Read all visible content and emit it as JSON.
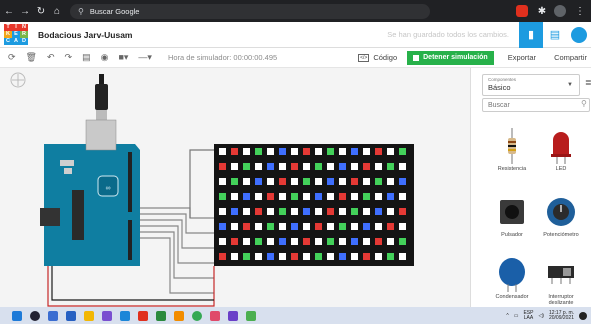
{
  "browser": {
    "omnibox_text": "Buscar Google",
    "back_icon": "back-arrow-icon",
    "forward_icon": "forward-arrow-icon",
    "reload_icon": "reload-icon",
    "home_icon": "home-icon"
  },
  "header": {
    "logo_letters": [
      "T",
      "I",
      "N",
      "K",
      "E",
      "R",
      "C",
      "A",
      "D"
    ],
    "logo_colors": [
      "#e8362a",
      "#e8362a",
      "#e8362a",
      "#f1a71a",
      "#1d9be0",
      "#7ab648",
      "#1d9be0",
      "#1d9be0",
      "#1d9be0"
    ],
    "project_name": "Bodacious Jarv-Uusam",
    "save_status": "Se han guardado todos los cambios."
  },
  "toolbar": {
    "sim_time": "Hora de simulador: 00:00:00.495",
    "code_label": "Código",
    "stop_label": "Detener simulación",
    "export_label": "Exportar",
    "share_label": "Compartir"
  },
  "panel": {
    "components_label": "Componentes",
    "components_value": "Básico",
    "search_placeholder": "Buscar",
    "items": [
      {
        "label": "Resistencia"
      },
      {
        "label": "LED"
      },
      {
        "label": "Pulsador"
      },
      {
        "label": "Potenciómetro"
      },
      {
        "label": "Condensador"
      },
      {
        "label": "Interruptor deslizante"
      }
    ]
  },
  "taskbar": {
    "lang": "ESP",
    "lang_sub": "LAA",
    "time": "12:17 p. m.",
    "date": "20/09/2021"
  },
  "colors": {
    "accent_blue": "#1d9be0",
    "sim_green": "#27b14a",
    "board_teal": "#0f7ea1",
    "matrix_black": "#141414"
  }
}
